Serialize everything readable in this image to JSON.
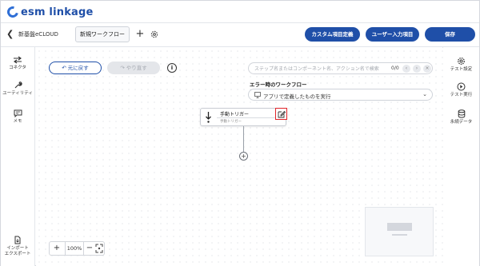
{
  "brand": {
    "logo_text": "esm linkage"
  },
  "toolbar": {
    "folder_name": "新基盤eCLOUD",
    "active_tab": "新規ワークフロー",
    "custom_fields_label": "カスタム項目定義",
    "user_input_label": "ユーザー入力項目",
    "save_label": "保存"
  },
  "left_sidebar": {
    "items": [
      {
        "label": "コネクタ",
        "icon": "connector-arrows-icon"
      },
      {
        "label": "ユーティリティ",
        "icon": "wrench-icon"
      },
      {
        "label": "メモ",
        "icon": "memo-icon"
      },
      {
        "label_line1": "インポート",
        "label_line2": "エクスポート",
        "icon": "file-import-icon"
      }
    ]
  },
  "right_sidebar": {
    "items": [
      {
        "label": "テスト設定",
        "icon": "gear-icon"
      },
      {
        "label": "テスト実行",
        "icon": "play-icon"
      },
      {
        "label": "永続データ",
        "icon": "database-icon"
      }
    ]
  },
  "canvas": {
    "undo_label": "元に戻す",
    "redo_label": "やり直す",
    "search": {
      "placeholder": "ステップ名またはコンポーネント名、アクション名で検索",
      "value": "",
      "count": "0/0"
    },
    "error_flow": {
      "label": "エラー時のワークフロー",
      "selected": "アプリで定義したものを実行"
    },
    "trigger_node": {
      "title": "手動トリガー",
      "subtitle": "手動トリガー"
    },
    "zoom": {
      "value": "100%"
    }
  },
  "colors": {
    "primary": "#1f4fa8",
    "highlight": "#e0242a"
  }
}
